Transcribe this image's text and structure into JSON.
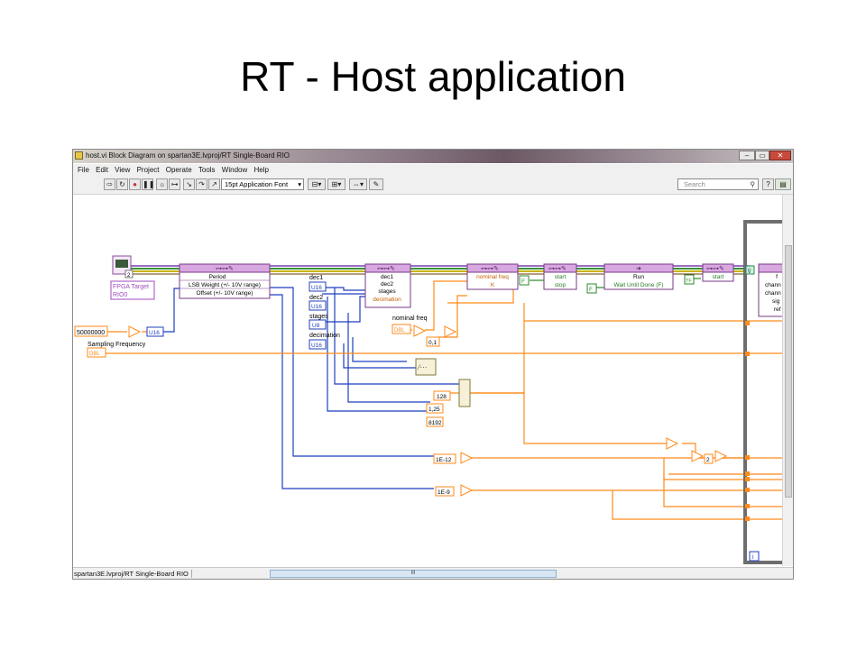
{
  "slide": {
    "title": "RT - Host application"
  },
  "window": {
    "title": "host.vi Block Diagram on spartan3E.lvproj/RT Single-Board RIO",
    "menu": [
      "File",
      "Edit",
      "View",
      "Project",
      "Operate",
      "Tools",
      "Window",
      "Help"
    ],
    "toolbar": {
      "font": "15pt Application Font",
      "search_placeholder": "Search",
      "help": "?"
    },
    "statusbar": {
      "path": "spartan3E.lvproj/RT Single-Board RIO",
      "scroll_label": "III"
    }
  },
  "diagram": {
    "fpga": {
      "label": "FPGA Target",
      "target": "RIO0",
      "badge": "2"
    },
    "node1": {
      "items": [
        "Period",
        "LSB Weight (+/- 10V range)",
        "Offset (+/- 10V range)"
      ]
    },
    "node2": {
      "items": [
        "dec1",
        "dec2",
        "stages",
        "decimation"
      ]
    },
    "node3": {
      "items": [
        "nominal freq",
        "K"
      ]
    },
    "node4": {
      "items": [
        "start",
        "stop"
      ]
    },
    "node5": {
      "items": [
        "Run",
        "Wait Until Done (F)"
      ]
    },
    "node6": {
      "items": [
        "start"
      ]
    },
    "node7": {
      "items": [
        "f",
        "chann",
        "chann",
        "sig",
        "ref"
      ]
    },
    "labels": {
      "dec1": "dec1",
      "dec2": "dec2",
      "stages": "stages",
      "decimation": "decimation",
      "nominal_freq": "nominal freq",
      "sampling_frequency": "Sampling Frequency"
    },
    "types": {
      "u16": "U16",
      "u8": "U8",
      "dbl": "DBL",
      "f": "F",
      "tf": "TF",
      "i": "i"
    },
    "constants": {
      "c50000000": "50000000",
      "c01": "0,1",
      "c128": "128",
      "c125": "1,25",
      "c8192": "8192",
      "c1e12": "1E-12",
      "c1e9": "1E-9",
      "c2": "2"
    }
  }
}
